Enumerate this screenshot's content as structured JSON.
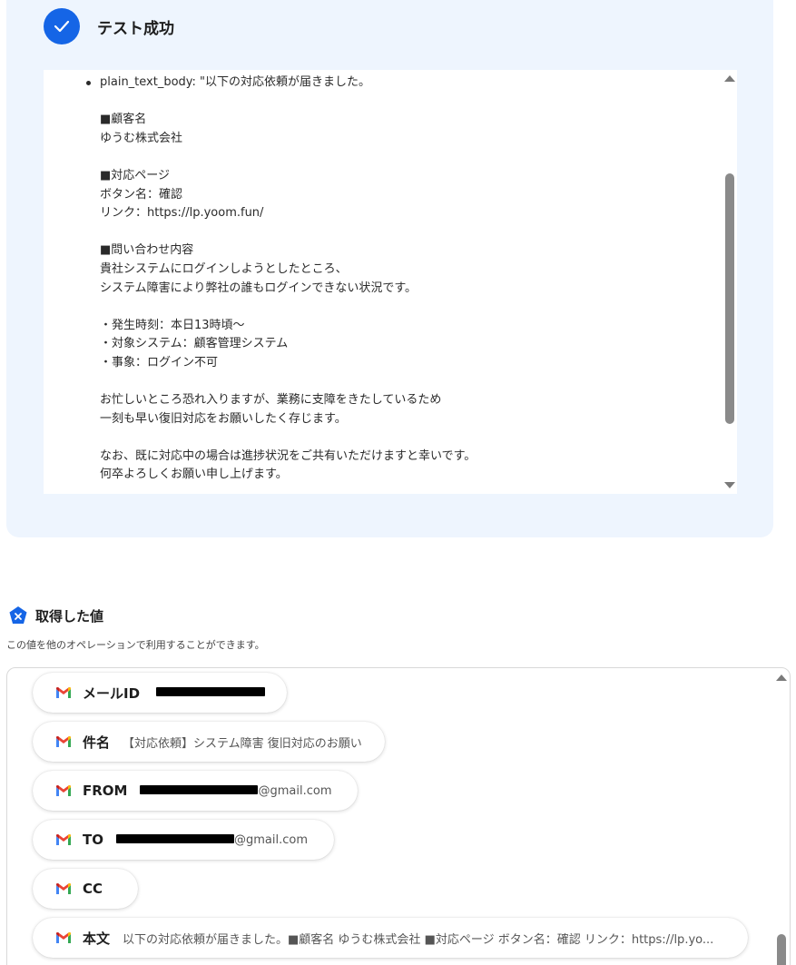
{
  "test_result": {
    "title": "テスト成功",
    "body_text": "plain_text_body: \"以下の対応依頼が届きました。\n\n■顧客名\nゆうむ株式会社\n\n■対応ページ\nボタン名：確認\nリンク：https://lp.yoom.fun/\n\n■問い合わせ内容\n貴社システムにログインしようとしたところ、\nシステム障害により弊社の誰もログインできない状況です。\n\n・発生時刻：本日13時頃～\n・対象システム：顧客管理システム\n・事象：ログイン不可\n\nお忙しいところ恐れ入りますが、業務に支障をきたしているため\n一刻も早い復旧対応をお願いしたく存じます。\n\nなお、既に対応中の場合は進捗状況をご共有いただけますと幸いです。\n何卒よろしくお願い申し上げます。"
  },
  "acquired_values": {
    "title": "取得した値",
    "description": "この値を他のオペレーションで利用することができます。",
    "items": [
      {
        "label": "メールID",
        "value": ""
      },
      {
        "label": "件名",
        "value": "【対応依頼】システム障害 復旧対応のお願い"
      },
      {
        "label": "FROM",
        "value": "@gmail.com"
      },
      {
        "label": "TO",
        "value": "@gmail.com"
      },
      {
        "label": "CC",
        "value": ""
      },
      {
        "label": "本文",
        "value": "以下の対応依頼が届きました。■顧客名 ゆうむ株式会社 ■対応ページ ボタン名：確認 リンク：https://lp.yo..."
      }
    ]
  },
  "colors": {
    "accent": "#1565e6",
    "panel_bg": "#eef5fe"
  },
  "icons": {
    "success": "check-icon",
    "values": "variable-badge-icon",
    "source": "gmail-icon"
  }
}
